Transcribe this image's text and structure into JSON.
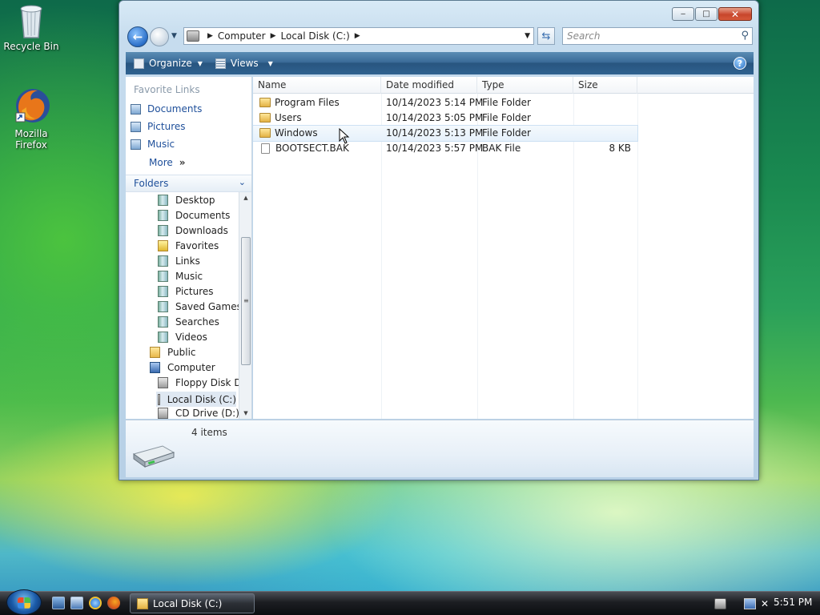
{
  "desktop": {
    "icons": [
      {
        "label": "Recycle Bin"
      },
      {
        "label": "Mozilla\nFirefox"
      }
    ]
  },
  "window": {
    "controls": {
      "minimize": "‒",
      "maximize": "□",
      "close": "✕"
    },
    "address": {
      "crumbs": [
        "Computer",
        "Local Disk (C:)"
      ]
    },
    "search": {
      "placeholder": "Search"
    },
    "commands": {
      "organize": "Organize",
      "views": "Views",
      "help": "?"
    },
    "left_pane": {
      "favorite_links_title": "Favorite Links",
      "favorites": [
        "Documents",
        "Pictures",
        "Music"
      ],
      "more_label": "More",
      "more_glyph": "»",
      "folders_title": "Folders",
      "tree": [
        {
          "label": "Desktop",
          "icon": "folder-special-icon"
        },
        {
          "label": "Documents",
          "icon": "folder-special-icon"
        },
        {
          "label": "Downloads",
          "icon": "folder-special-icon"
        },
        {
          "label": "Favorites",
          "icon": "favorites-icon"
        },
        {
          "label": "Links",
          "icon": "folder-special-icon"
        },
        {
          "label": "Music",
          "icon": "folder-special-icon"
        },
        {
          "label": "Pictures",
          "icon": "folder-special-icon"
        },
        {
          "label": "Saved Games",
          "icon": "folder-special-icon"
        },
        {
          "label": "Searches",
          "icon": "folder-special-icon"
        },
        {
          "label": "Videos",
          "icon": "folder-special-icon"
        },
        {
          "label": "Public",
          "icon": "folder-icon"
        },
        {
          "label": "Computer",
          "icon": "computer-icon"
        },
        {
          "label": "Floppy Disk Dr",
          "icon": "floppy-drive-icon"
        },
        {
          "label": "Local Disk (C:)",
          "icon": "hard-drive-icon",
          "selected": true
        },
        {
          "label": "CD Drive (D:)",
          "icon": "cd-drive-icon"
        }
      ]
    },
    "columns": {
      "name": "Name",
      "date": "Date modified",
      "type": "Type",
      "size": "Size"
    },
    "files": [
      {
        "name": "Program Files",
        "date": "10/14/2023 5:14 PM",
        "type": "File Folder",
        "size": "",
        "kind": "folder"
      },
      {
        "name": "Users",
        "date": "10/14/2023 5:05 PM",
        "type": "File Folder",
        "size": "",
        "kind": "folder"
      },
      {
        "name": "Windows",
        "date": "10/14/2023 5:13 PM",
        "type": "File Folder",
        "size": "",
        "kind": "folder"
      },
      {
        "name": "BOOTSECT.BAK",
        "date": "10/14/2023 5:57 PM",
        "type": "BAK File",
        "size": "8 KB",
        "kind": "file"
      }
    ],
    "details": {
      "item_count": "4 items"
    }
  },
  "taskbar": {
    "task_label": "Local Disk (C:)",
    "clock": "5:51 PM"
  },
  "colors": {
    "link_blue": "#1e4f9a",
    "command_bar": "#3a6b98"
  }
}
